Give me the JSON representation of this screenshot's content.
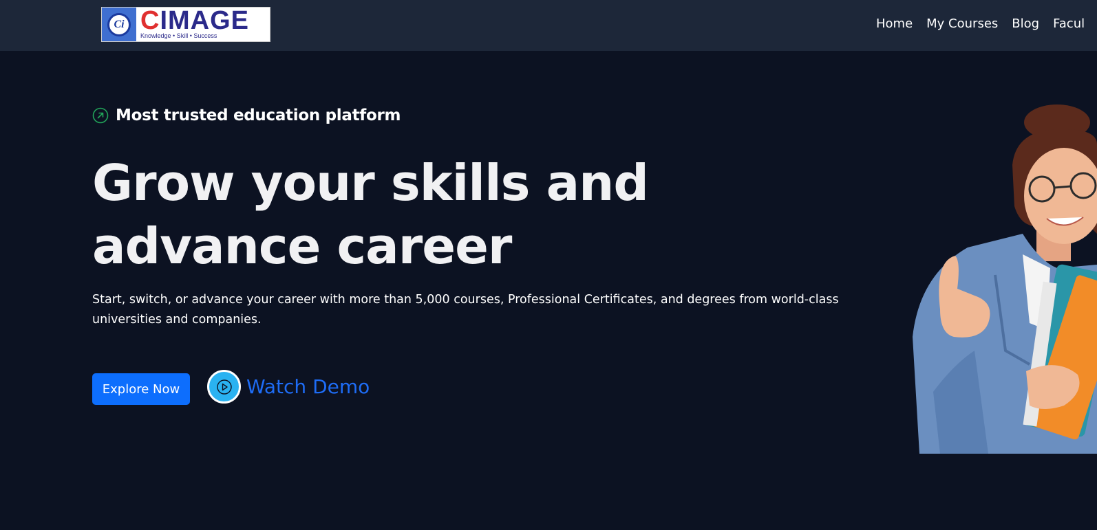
{
  "header": {
    "logo": {
      "brand": "CIMAGE",
      "emblem_text": "Ci",
      "tagline": "Knowledge • Skill • Success"
    },
    "nav": [
      "Home",
      "My Courses",
      "Blog",
      "Facul"
    ]
  },
  "hero": {
    "badge": {
      "icon": "arrow-up-right-circle-icon",
      "text": "Most trusted education platform"
    },
    "headline": "Grow your skills and advance career",
    "subtext": "Start, switch, or advance your career with more than 5,000 courses, Professional Certificates, and degrees from world-class universities and companies.",
    "explore_label": "Explore Now",
    "demo": {
      "icon": "play-icon",
      "label": "Watch Demo"
    }
  },
  "colors": {
    "background": "#0c1222",
    "navbar": "#1d2739",
    "primary_button": "#0d6efd",
    "demo_circle": "#2ab2f1",
    "demo_text": "#1e6cf5",
    "badge_icon": "#22a55a"
  }
}
